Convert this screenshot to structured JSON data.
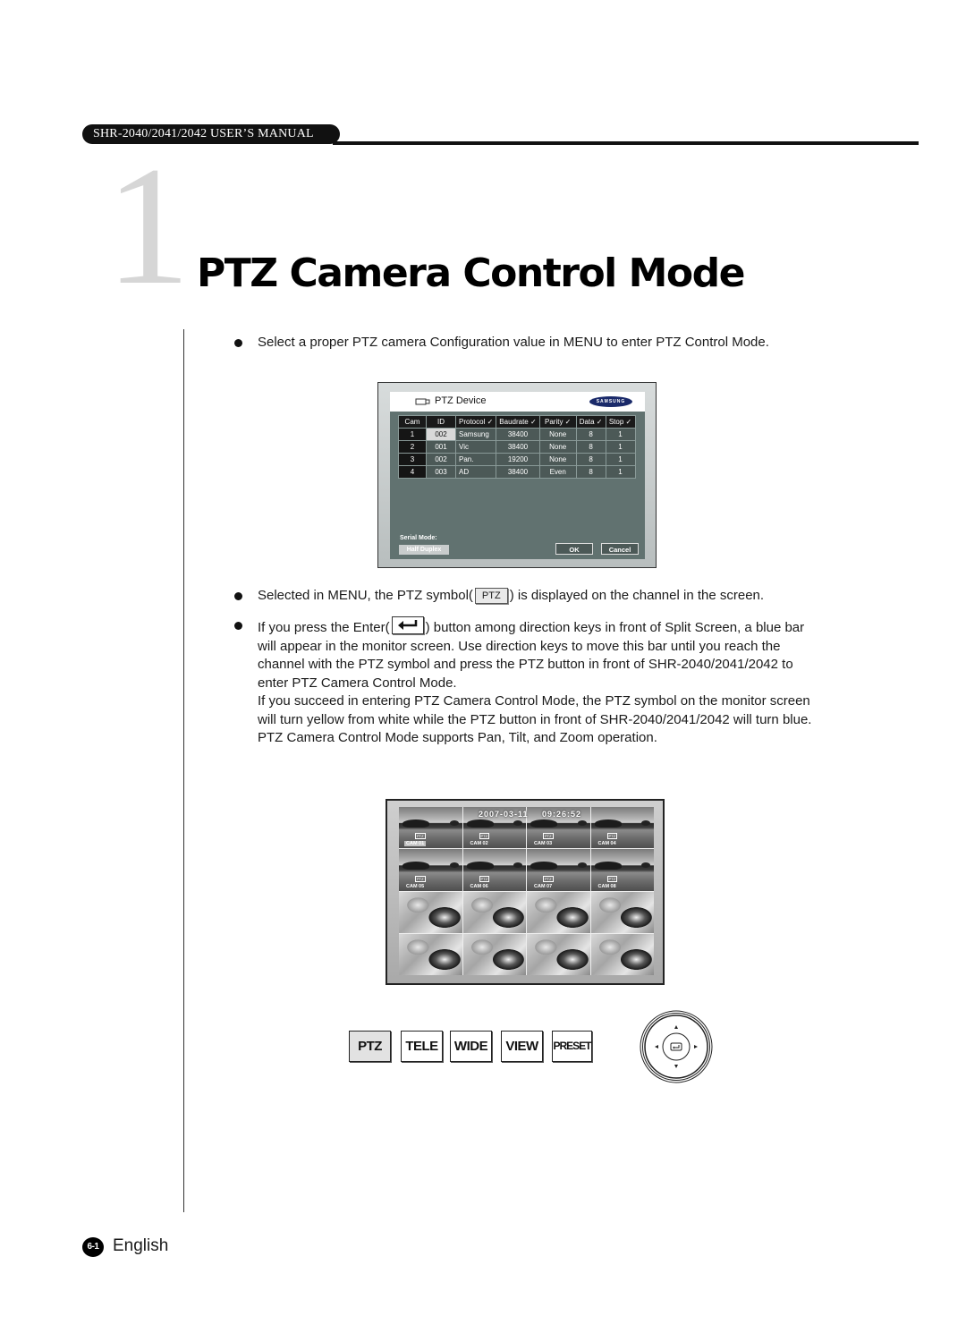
{
  "header": {
    "manual_title": "SHR-2040/2041/2042 USER’S MANUAL"
  },
  "chapter": {
    "number": "1",
    "title": "PTZ Camera Control Mode"
  },
  "bullets": [
    {
      "text": "Select a proper PTZ camera Configuration value in MENU to enter PTZ Control Mode."
    },
    {
      "before": "Selected in MENU, the PTZ symbol(",
      "symbol": "PTZ",
      "after": ") is displayed on the channel in the screen."
    },
    {
      "before": "If you press the Enter(",
      "icon": "enter-key-icon",
      "after": ") button among direction keys in front of Split Screen, a blue bar will appear in the monitor screen. Use direction keys to move this bar until you reach the channel with the PTZ symbol and press the PTZ button in front of SHR-2040/2041/2042 to enter PTZ Camera Control Mode.",
      "paragraph2": "If you succeed in entering PTZ Camera Control Mode, the PTZ symbol on the monitor screen will turn yellow from white while the PTZ button in front of SHR-2040/2041/2042 will turn blue. PTZ Camera Control Mode supports Pan, Tilt, and Zoom operation."
    }
  ],
  "ptz_dialog": {
    "title": "PTZ Device",
    "brand": "SAMSUNG",
    "columns": [
      "Cam",
      "ID",
      "Protocol ✓",
      "Baudrate ✓",
      "Parity ✓",
      "Data ✓",
      "Stop ✓"
    ],
    "rows": [
      [
        "1",
        "002",
        "Samsung",
        "38400",
        "None",
        "8",
        "1"
      ],
      [
        "2",
        "001",
        "Vic",
        "38400",
        "None",
        "8",
        "1"
      ],
      [
        "3",
        "002",
        "Pan.",
        "19200",
        "None",
        "8",
        "1"
      ],
      [
        "4",
        "003",
        "AD",
        "38400",
        "Even",
        "8",
        "1"
      ]
    ],
    "serial_mode_label": "Serial Mode:",
    "serial_mode_value": "Half Duplex",
    "ok_label": "OK",
    "cancel_label": "Cancel"
  },
  "monitor": {
    "date": "2007-03-11",
    "time": "09:26:52",
    "ptz_mark": "PTZ",
    "cameras": [
      "CAM 01",
      "CAM 02",
      "CAM 03",
      "CAM 04",
      "CAM 05",
      "CAM 06",
      "CAM 07",
      "CAM 08"
    ],
    "selected_camera": "CAM 01"
  },
  "front_panel": {
    "buttons": [
      "PTZ",
      "TELE",
      "WIDE",
      "VIEW",
      "PRESET"
    ]
  },
  "footer": {
    "page_number": "6-1",
    "language": "English"
  }
}
